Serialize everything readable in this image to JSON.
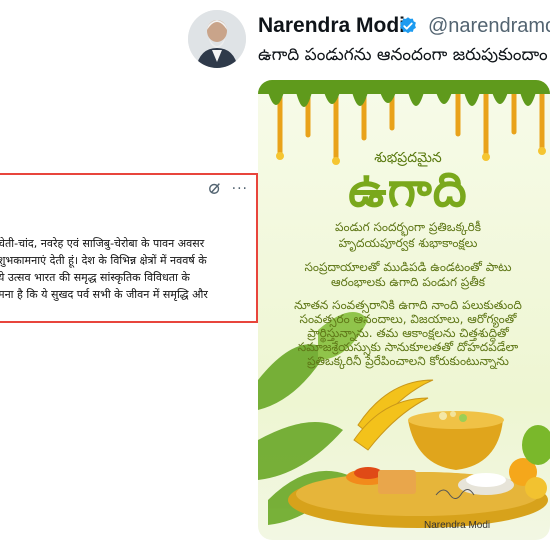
{
  "tweet": {
    "author_name": "Narendra Modi",
    "handle": "@narendramodi",
    "text": "ఉగాది పండుగను ఆనందంగా జరుపుకుందాం"
  },
  "greeting": {
    "subtitle": "శుభప్రదమైన",
    "title": "ఉగాది",
    "line1": "పండుగ సందర్భంగా ప్రతిఒక్కరికీ",
    "line2": "హృదయపూర్వక శుభాకాంక్షలు",
    "para1a": "సంప్రదాయాలతో ముడిపడి ఉండటంతో పాటు",
    "para1b": "ఆరంభాలకు ఉగాది పండుగ ప్రతీక",
    "para2a": "నూతన సంవత్సరానికి ఉగాది నాంది పలుకుతుంది",
    "para2b": "సంవత్సరం ఆనందాలు, విజయాలు, ఆరోగ్యంతో",
    "para2c": "ప్రార్థిస్తున్నాను. తమ ఆకాంక్షలను చిత్తశుద్ధితో",
    "para2d": "సమాజశ్రేయస్సుకు సానుకూలతతో దోహదపడేలా",
    "para2e": "ప్రతిఒక్కరినీ ప్రేరేపించాలని కోరుకుంటున్నాను",
    "signature": "Narendra Modi"
  },
  "hindi_post": {
    "more": "···",
    "lines": [
      "चेती-चांद, नवरेह एवं साजिबु-चेरोबा के पावन अवसर",
      "शुभकामनाएं देती हूं। देश के विभिन्न क्षेत्रों में नववर्ष के",
      "ये उत्सव भारत की समृद्ध सांस्कृतिक विविधता के",
      "मना है कि ये सुखद पर्व सभी के जीवन में समृद्धि और"
    ]
  },
  "colors": {
    "accent_green": "#7aa81c",
    "verified_blue": "#1d9bf0",
    "card_border": "#e8453c"
  }
}
